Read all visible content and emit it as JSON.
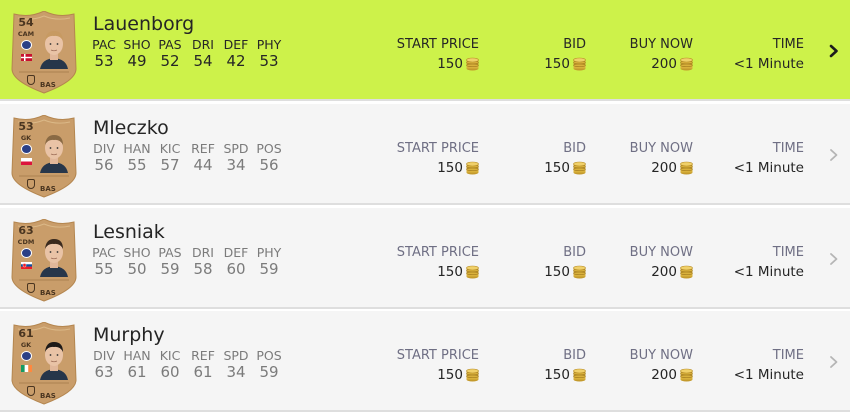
{
  "colors": {
    "selected_bg": "#cdf24a",
    "row_bg": "#f5f5f5",
    "card_gold": "#c99d6a"
  },
  "listings": [
    {
      "selected": true,
      "name": "Lauenborg",
      "rating": "54",
      "position": "CAM",
      "rarity": "BAS",
      "nation_flag": "denmark-flag",
      "stats": [
        {
          "label": "PAC",
          "value": "53"
        },
        {
          "label": "SHO",
          "value": "49"
        },
        {
          "label": "PAS",
          "value": "52"
        },
        {
          "label": "DRI",
          "value": "54"
        },
        {
          "label": "DEF",
          "value": "42"
        },
        {
          "label": "PHY",
          "value": "53"
        }
      ],
      "start_price_label": "START PRICE",
      "start_price": "150",
      "bid_label": "BID",
      "bid": "150",
      "buy_now_label": "BUY NOW",
      "buy_now": "200",
      "time_label": "TIME",
      "time": "<1 Minute"
    },
    {
      "selected": false,
      "name": "Mleczko",
      "rating": "53",
      "position": "GK",
      "rarity": "BAS",
      "nation_flag": "poland-flag",
      "stats": [
        {
          "label": "DIV",
          "value": "56"
        },
        {
          "label": "HAN",
          "value": "55"
        },
        {
          "label": "KIC",
          "value": "57"
        },
        {
          "label": "REF",
          "value": "44"
        },
        {
          "label": "SPD",
          "value": "34"
        },
        {
          "label": "POS",
          "value": "56"
        }
      ],
      "start_price_label": "START PRICE",
      "start_price": "150",
      "bid_label": "BID",
      "bid": "150",
      "buy_now_label": "BUY NOW",
      "buy_now": "200",
      "time_label": "TIME",
      "time": "<1 Minute"
    },
    {
      "selected": false,
      "name": "Lesniak",
      "rating": "63",
      "position": "CDM",
      "rarity": "BAS",
      "nation_flag": "slovakia-flag",
      "stats": [
        {
          "label": "PAC",
          "value": "55"
        },
        {
          "label": "SHO",
          "value": "50"
        },
        {
          "label": "PAS",
          "value": "59"
        },
        {
          "label": "DRI",
          "value": "58"
        },
        {
          "label": "DEF",
          "value": "60"
        },
        {
          "label": "PHY",
          "value": "59"
        }
      ],
      "start_price_label": "START PRICE",
      "start_price": "150",
      "bid_label": "BID",
      "bid": "150",
      "buy_now_label": "BUY NOW",
      "buy_now": "200",
      "time_label": "TIME",
      "time": "<1 Minute"
    },
    {
      "selected": false,
      "name": "Murphy",
      "rating": "61",
      "position": "GK",
      "rarity": "BAS",
      "nation_flag": "ireland-flag",
      "stats": [
        {
          "label": "DIV",
          "value": "63"
        },
        {
          "label": "HAN",
          "value": "61"
        },
        {
          "label": "KIC",
          "value": "60"
        },
        {
          "label": "REF",
          "value": "61"
        },
        {
          "label": "SPD",
          "value": "34"
        },
        {
          "label": "POS",
          "value": "59"
        }
      ],
      "start_price_label": "START PRICE",
      "start_price": "150",
      "bid_label": "BID",
      "bid": "150",
      "buy_now_label": "BUY NOW",
      "buy_now": "200",
      "time_label": "TIME",
      "time": "<1 Minute"
    }
  ]
}
